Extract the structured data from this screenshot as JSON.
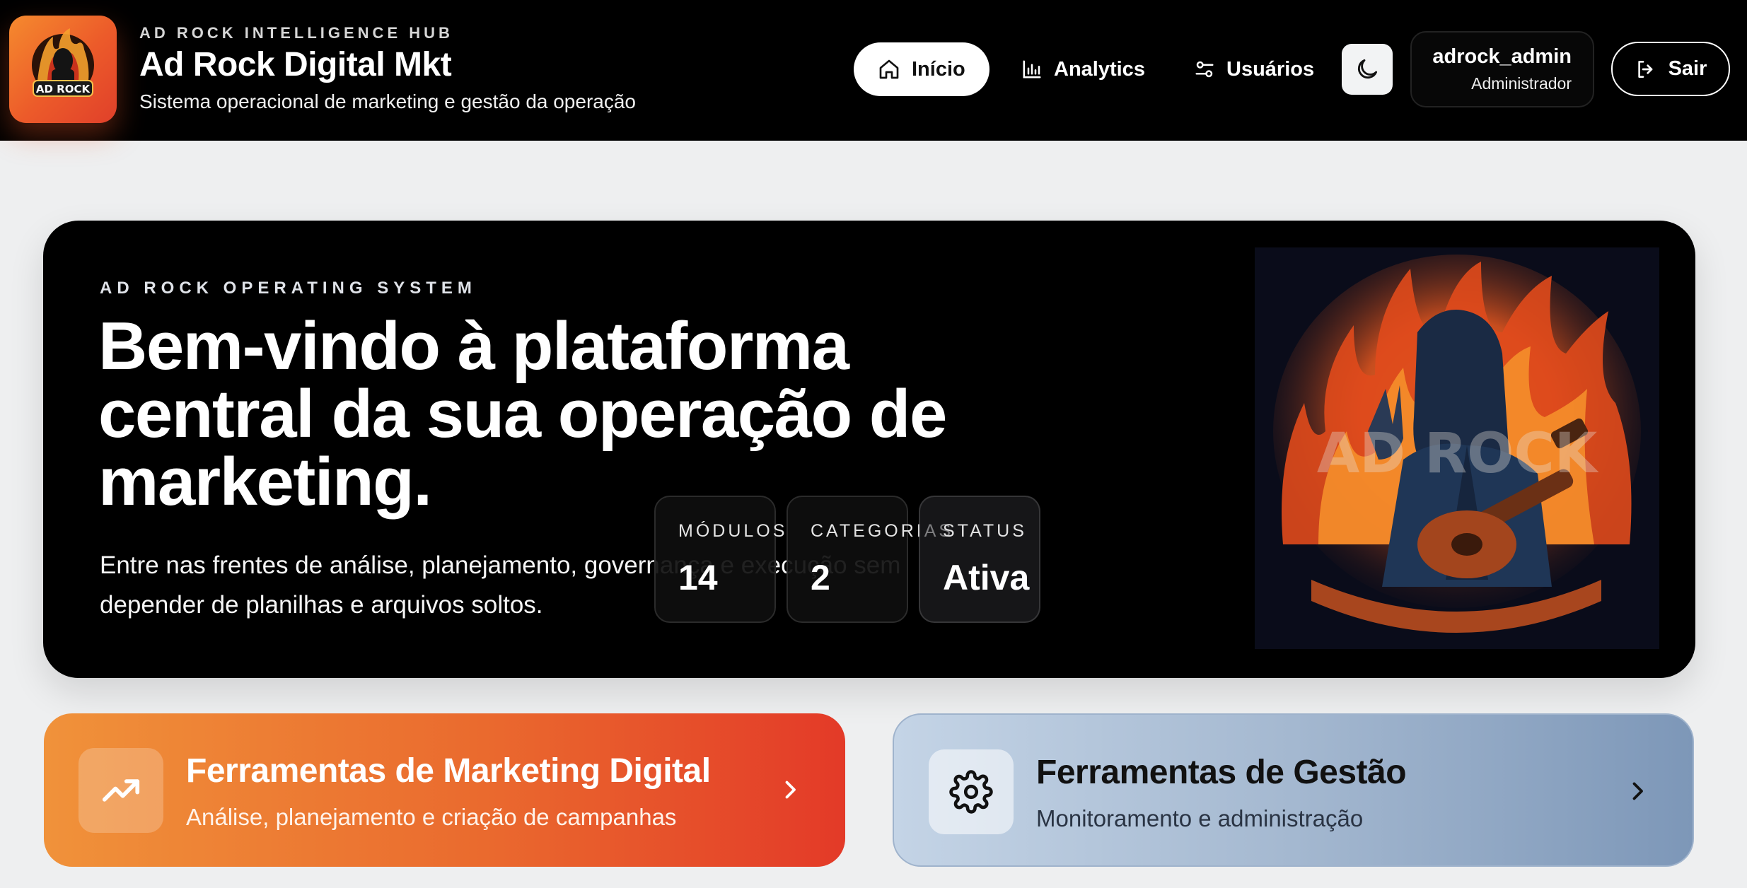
{
  "brand": {
    "kicker": "AD ROCK INTELLIGENCE HUB",
    "title": "Ad Rock Digital Mkt",
    "subtitle": "Sistema operacional de marketing e gestão da operação",
    "logo_text": "AD ROCK",
    "accent": "#ec5a2a"
  },
  "nav": {
    "items": [
      {
        "label": "Início",
        "icon": "home-icon",
        "active": true
      },
      {
        "label": "Analytics",
        "icon": "bar-chart-icon",
        "active": false
      },
      {
        "label": "Usuários",
        "icon": "sliders-icon",
        "active": false
      }
    ],
    "theme_toggle_icon": "moon-icon"
  },
  "user": {
    "name": "adrock_admin",
    "role": "Administrador"
  },
  "logout": {
    "label": "Sair",
    "icon": "logout-icon"
  },
  "hero": {
    "kicker": "AD ROCK OPERATING SYSTEM",
    "title": "Bem-vindo à plataforma central da sua operação de marketing.",
    "description": "Entre nas frentes de análise, planejamento, governança e execução sem depender de planilhas e arquivos soltos.",
    "stats": [
      {
        "label": "MÓDULOS",
        "value": "14"
      },
      {
        "label": "CATEGORIAS",
        "value": "2"
      },
      {
        "label": "STATUS",
        "value": "Ativa"
      }
    ]
  },
  "tools": [
    {
      "title": "Ferramentas de Marketing Digital",
      "subtitle": "Análise, planejamento e criação de campanhas",
      "icon": "trending-up-icon",
      "color": "#e33a28"
    },
    {
      "title": "Ferramentas de Gestão",
      "subtitle": "Monitoramento e administração",
      "icon": "gear-icon",
      "color": "#7d97b8"
    }
  ]
}
